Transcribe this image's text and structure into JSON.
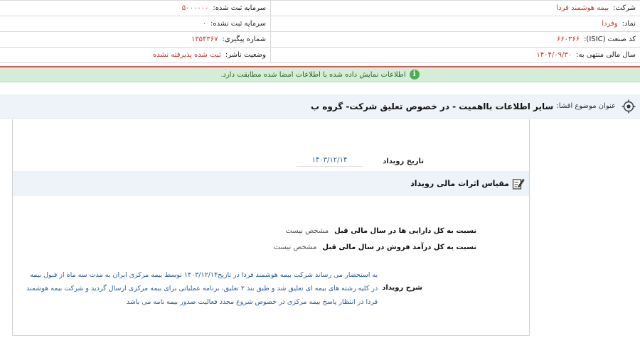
{
  "info": {
    "rows": [
      {
        "right_label": "شرکت:",
        "right_value": "بیمه هوشمند فردا",
        "left_label": "سرمایه ثبت شده:",
        "left_value": "۵۰۰۰۰۰۰"
      },
      {
        "right_label": "نماد:",
        "right_value": "وفردا",
        "left_label": "سرمایه ثبت نشده:",
        "left_value": "۰"
      },
      {
        "right_label": "کد صنعت (ISIC):",
        "right_value": "۶۶۰۳۶۶",
        "left_label": "شماره پیگیری:",
        "left_value": "۱۳۵۴۳۶۷"
      },
      {
        "right_label": "سال مالی منتهی به:",
        "right_value": "۱۴۰۴/۰۹/۳۰",
        "left_label": "وضعیت ناشر:",
        "left_value": "ثبت شده پذیرفته نشده"
      }
    ]
  },
  "banner": {
    "icon": "info-icon",
    "text": "اطلاعات نمایش داده شده با اطلاعات امضا شده مطابقت دارد."
  },
  "subject": {
    "label": "عنوان موضوع افشا:",
    "title": "سایر اطلاعات بااهمیت - در خصوص تعلیق شرکت- گروه ب"
  },
  "event": {
    "date_label": "تاریخ رویداد",
    "date_value": "۱۴۰۳/۱۲/۱۴"
  },
  "section": {
    "title": "مقیاس اثرات مالی رویداد"
  },
  "ratios": [
    {
      "label": "نسبت به کل دارایی ها در سال مالی قبل",
      "value": "مشخص نیست"
    },
    {
      "label": "نسبت به کل درآمد فروش در سال مالی قبل",
      "value": "مشخص نیست"
    }
  ],
  "description": {
    "label": "شرح رویداد",
    "text": "به استحضار می رساند شرکت بیمه هوشمند فردا در تاریخ۱۴۰۳/۱۲/۱۴ توسط بیمه مرکزی ایران به مدت سه ماه از قبول بیمه در کلیه رشته های بیمه ای تعلیق شد و طبق بند ۲ تعلیق، برنامه عملیاتی برای بیمه مرکزی ارسال گردید و شرکت بیمه هوشمند فردا در انتظار پاسخ بیمه مرکزی در خصوص شروع مجدد فعالیت صدور بیمه نامه می باشد"
  }
}
